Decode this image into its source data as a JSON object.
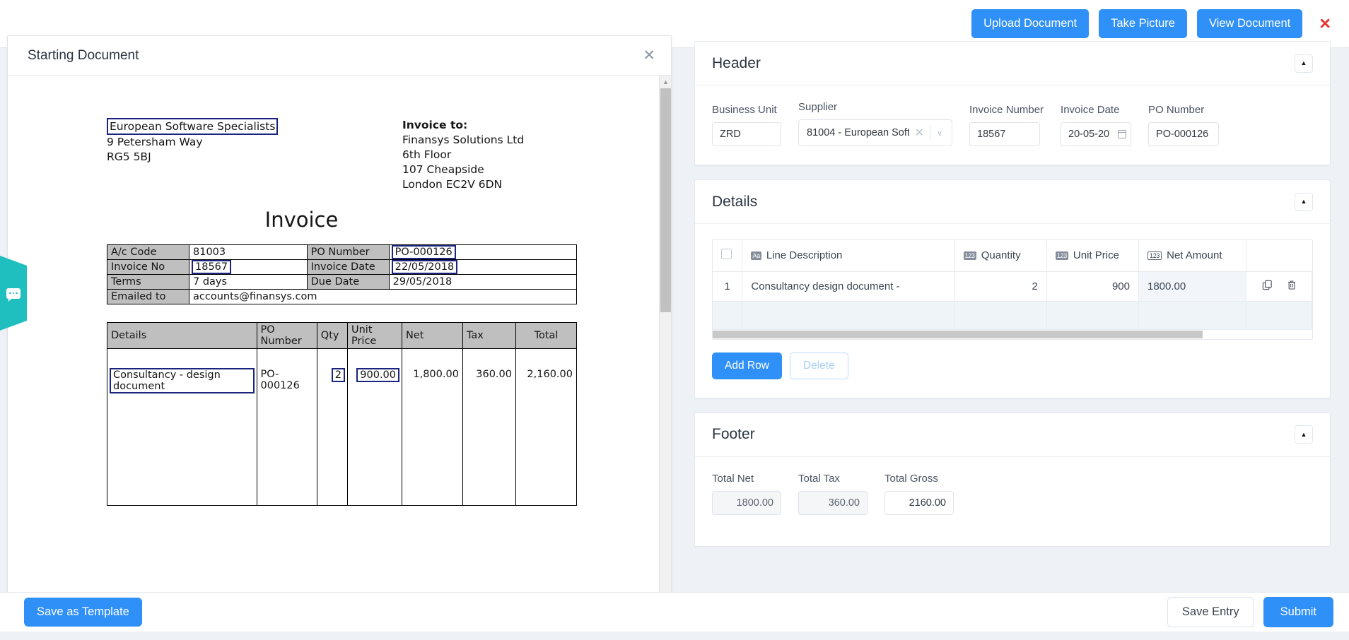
{
  "topbar": {
    "upload_label": "Upload Document",
    "take_picture_label": "Take Picture",
    "view_document_label": "View Document",
    "close_label": "×"
  },
  "document_panel": {
    "title": "Starting Document",
    "close_label": "✕",
    "company": {
      "name": "European Software Specialists",
      "address_line1": "9 Petersham Way",
      "address_line2": "RG5 5BJ"
    },
    "invoice_to": {
      "heading": "Invoice to:",
      "line1": "Finansys Solutions Ltd",
      "line2": "6th Floor",
      "line3": "107 Cheapside",
      "line4": "London EC2V 6DN"
    },
    "doc_title": "Invoice",
    "meta_table": {
      "rows": [
        {
          "label1": "A/c Code",
          "value1": "81003",
          "label2": "PO Number",
          "value2": "PO-000126"
        },
        {
          "label1": "Invoice No",
          "value1": "18567",
          "label2": "Invoice Date",
          "value2": "22/05/2018"
        },
        {
          "label1": "Terms",
          "value1": "7 days",
          "label2": "Due Date",
          "value2": "29/05/2018"
        },
        {
          "label1": "Emailed to",
          "value1": "accounts@finansys.com",
          "label2": "",
          "value2": ""
        }
      ]
    },
    "items_table": {
      "headers": [
        "Details",
        "PO Number",
        "Qty",
        "Unit Price",
        "Net",
        "Tax",
        "Total"
      ],
      "rows": [
        {
          "details": "Consultancy - design document",
          "po_number": "PO-000126",
          "qty": "2",
          "unit_price": "900.00",
          "net": "1,800.00",
          "tax": "360.00",
          "total": "2,160.00"
        }
      ]
    }
  },
  "header_card": {
    "title": "Header",
    "collapse_label": "▲",
    "fields": {
      "business_unit": {
        "label": "Business Unit",
        "value": "ZRD"
      },
      "supplier": {
        "label": "Supplier",
        "value": "81004 - European Soft…",
        "clear": "✕",
        "caret": "∨"
      },
      "invoice_number": {
        "label": "Invoice Number",
        "value": "18567"
      },
      "invoice_date": {
        "label": "Invoice Date",
        "value": "20-05-20"
      },
      "po_number": {
        "label": "PO Number",
        "value": "PO-000126"
      }
    }
  },
  "details_card": {
    "title": "Details",
    "collapse_label": "▲",
    "grid": {
      "columns": [
        {
          "label": "Line Description",
          "icon": "text-type-icon",
          "icon_text": "Aa"
        },
        {
          "label": "Quantity",
          "icon": "number-type-icon",
          "icon_text": "123"
        },
        {
          "label": "Unit Price",
          "icon": "number-type-icon",
          "icon_text": "123"
        },
        {
          "label": "Net Amount",
          "icon": "formula-number-icon",
          "icon_text": "123"
        }
      ],
      "rows": [
        {
          "index": "1",
          "line_description": "Consultancy design document -",
          "quantity": "2",
          "unit_price": "900",
          "net_amount": "1800.00"
        }
      ]
    },
    "add_row_label": "Add Row",
    "delete_label": "Delete"
  },
  "footer_card": {
    "title": "Footer",
    "collapse_label": "▲",
    "total_net": {
      "label": "Total Net",
      "value": "1800.00"
    },
    "total_tax": {
      "label": "Total Tax",
      "value": "360.00"
    },
    "total_gross": {
      "label": "Total Gross",
      "value": "2160.00"
    }
  },
  "bottombar": {
    "save_template_label": "Save as Template",
    "save_entry_label": "Save Entry",
    "submit_label": "Submit"
  },
  "colors": {
    "primary": "#2f90f7",
    "close_red": "#e53935",
    "chat_teal": "#1fbfbf",
    "highlight_box": "#1a237e"
  }
}
